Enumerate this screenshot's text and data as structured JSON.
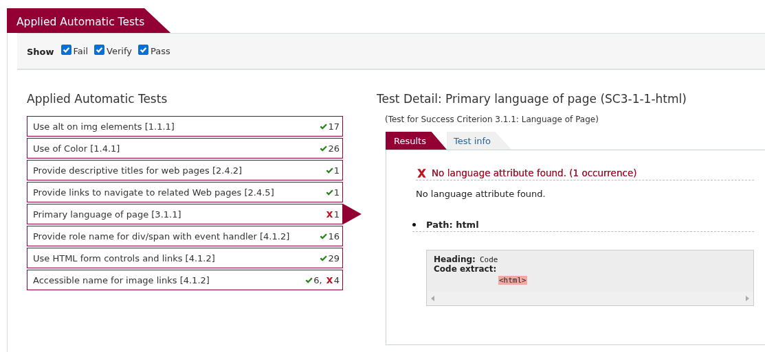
{
  "header_tab": {
    "label": "Applied Automatic Tests"
  },
  "filter_bar": {
    "label": "Show",
    "options": [
      {
        "label": "Fail",
        "checked": true
      },
      {
        "label": "Verify",
        "checked": true
      },
      {
        "label": "Pass",
        "checked": true
      }
    ]
  },
  "tests_list": {
    "title": "Applied Automatic Tests",
    "separator": ",",
    "items": [
      {
        "label": "Use alt on img elements [1.1.1]",
        "selected": false,
        "results": [
          {
            "kind": "pass",
            "count": "17"
          }
        ]
      },
      {
        "label": "Use of Color [1.4.1]",
        "selected": false,
        "results": [
          {
            "kind": "pass",
            "count": "26"
          }
        ]
      },
      {
        "label": "Provide descriptive titles for web pages [2.4.2]",
        "selected": false,
        "results": [
          {
            "kind": "pass",
            "count": "1"
          }
        ]
      },
      {
        "label": "Provide links to navigate to related Web pages [2.4.5]",
        "selected": false,
        "results": [
          {
            "kind": "pass",
            "count": "1"
          }
        ]
      },
      {
        "label": "Primary language of page [3.1.1]",
        "selected": true,
        "results": [
          {
            "kind": "fail",
            "count": "1"
          }
        ]
      },
      {
        "label": "Provide role name for div/span with event handler [4.1.2]",
        "selected": false,
        "results": [
          {
            "kind": "pass",
            "count": "16"
          }
        ]
      },
      {
        "label": "Use HTML form controls and links [4.1.2]",
        "selected": false,
        "results": [
          {
            "kind": "pass",
            "count": "29"
          }
        ]
      },
      {
        "label": "Accessible name for image links [4.1.2]",
        "selected": false,
        "results": [
          {
            "kind": "pass",
            "count": "6"
          },
          {
            "kind": "fail",
            "count": "4"
          }
        ]
      }
    ]
  },
  "test_detail": {
    "title": "Test Detail: Primary language of page (SC3-1-1-html)",
    "subtitle": "(Test for Success Criterion 3.1.1: Language of Page)",
    "tabs": [
      {
        "label": "Results",
        "selected": true
      },
      {
        "label": "Test info",
        "selected": false
      }
    ],
    "result": {
      "kind": "fail",
      "heading": "No language attribute found. (1 occurrence)",
      "message": "No language attribute found.",
      "occurrences": [
        {
          "path": "Path: html",
          "heading_label": "Heading:",
          "heading_value": "Code",
          "extract_label": "Code extract:",
          "extract": "<html>"
        }
      ]
    }
  }
}
